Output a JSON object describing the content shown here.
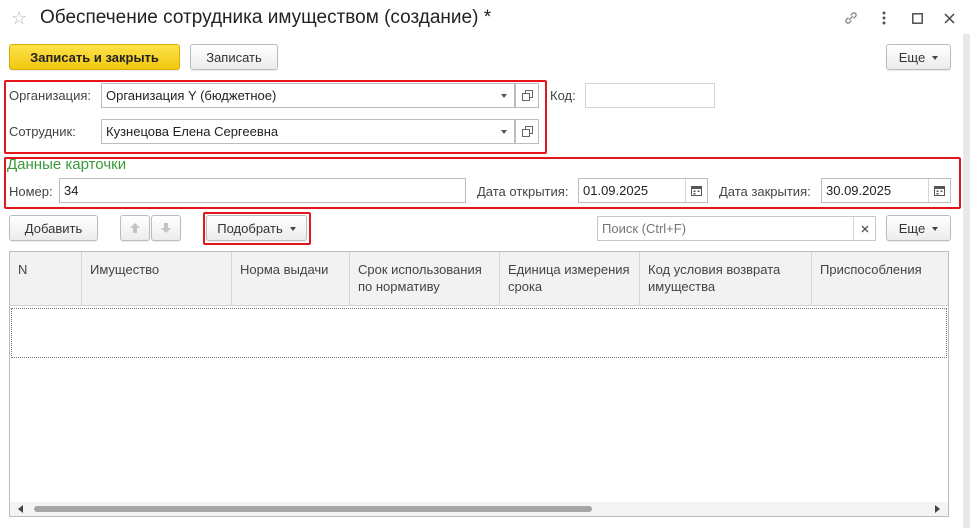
{
  "window": {
    "title": "Обеспечение сотрудника имуществом (создание) *"
  },
  "toolbar": {
    "save_close_label": "Записать и закрыть",
    "save_label": "Записать",
    "more_label": "Еще"
  },
  "header_fields": {
    "organization_label": "Организация:",
    "organization_value": "Организация Y (бюджетное)",
    "code_label": "Код:",
    "code_value": "",
    "employee_label": "Сотрудник:",
    "employee_value": "Кузнецова Елена Сергеевна"
  },
  "card": {
    "section_title": "Данные карточки",
    "number_label": "Номер:",
    "number_value": "34",
    "open_date_label": "Дата открытия:",
    "open_date_value": "01.09.2025",
    "close_date_label": "Дата закрытия:",
    "close_date_value": "30.09.2025"
  },
  "table_toolbar": {
    "add_label": "Добавить",
    "pick_label": "Подобрать",
    "search_placeholder": "Поиск (Ctrl+F)",
    "more_label": "Еще"
  },
  "table": {
    "columns": [
      "N",
      "Имущество",
      "Норма выдачи",
      "Срок использования по нормативу",
      "Единица измерения срока",
      "Код условия возврата имущества",
      "Приспособления"
    ]
  },
  "colors": {
    "highlight": "#e5151d",
    "primary_button": "#f2c810",
    "section_title": "#3a9a3a"
  }
}
